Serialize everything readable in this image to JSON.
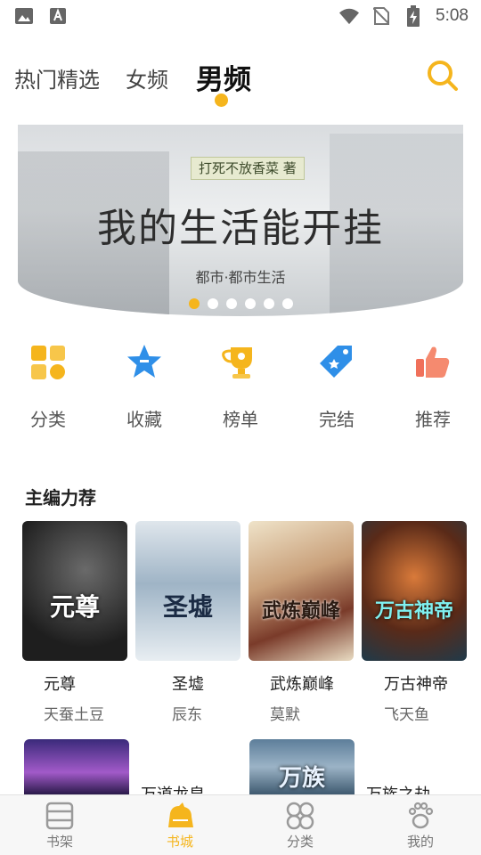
{
  "status_bar": {
    "time": "5:08",
    "icons": [
      "image-icon",
      "font-icon",
      "wifi-icon",
      "no-sim-icon",
      "battery-charging-icon"
    ]
  },
  "top_tabs": [
    {
      "label": "热门精选",
      "active": false
    },
    {
      "label": "女频",
      "active": false
    },
    {
      "label": "男频",
      "active": true
    }
  ],
  "banner": {
    "author_tag": "打死不放香菜 著",
    "title": "我的生活能开挂",
    "genre": "都市·都市生活",
    "page_count": 6,
    "active_page": 0
  },
  "categories": [
    {
      "label": "分类",
      "icon": "grid-icon",
      "color": "#f5b51d"
    },
    {
      "label": "收藏",
      "icon": "star-icon",
      "color": "#2f8fe8"
    },
    {
      "label": "榜单",
      "icon": "trophy-icon",
      "color": "#f5b51d"
    },
    {
      "label": "完结",
      "icon": "tag-icon",
      "color": "#2f8fe8"
    },
    {
      "label": "推荐",
      "icon": "thumbs-up-icon",
      "color": "#f0705a"
    }
  ],
  "section": {
    "title": "主编力荐"
  },
  "books": [
    {
      "name": "元尊",
      "author": "天蚕土豆",
      "cover_text": "元尊"
    },
    {
      "name": "圣墟",
      "author": "辰东",
      "cover_text": "圣墟"
    },
    {
      "name": "武炼巅峰",
      "author": "莫默",
      "cover_text": "武炼巅峰"
    },
    {
      "name": "万古神帝",
      "author": "飞天鱼",
      "cover_text": "万古神帝"
    },
    {
      "name": "万道龙皇",
      "author": "",
      "cover_text": ""
    },
    {
      "name": "万族之劫",
      "author": "",
      "cover_text": "万族"
    }
  ],
  "bottom_nav": [
    {
      "label": "书架",
      "icon": "bookshelf-icon",
      "active": false
    },
    {
      "label": "书城",
      "icon": "bookstore-icon",
      "active": true
    },
    {
      "label": "分类",
      "icon": "category-icon",
      "active": false
    },
    {
      "label": "我的",
      "icon": "paw-icon",
      "active": false
    }
  ],
  "colors": {
    "accent": "#f5b51d",
    "text_dark": "#222222",
    "text_muted": "#666666"
  }
}
